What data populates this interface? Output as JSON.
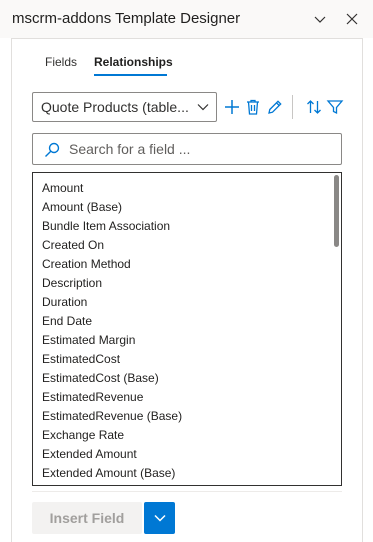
{
  "window": {
    "title": "mscrm-addons Template Designer"
  },
  "tabs": [
    {
      "label": "Fields",
      "active": false
    },
    {
      "label": "Relationships",
      "active": true
    }
  ],
  "relationship_dropdown": {
    "selected": "Quote Products (table..."
  },
  "toolbar": {
    "icons": [
      "add-icon",
      "delete-icon",
      "edit-icon",
      "sort-icon",
      "filter-icon"
    ]
  },
  "search": {
    "placeholder": "Search for a field ...",
    "value": ""
  },
  "fields": [
    "Amount",
    "Amount (Base)",
    "Bundle Item Association",
    "Created On",
    "Creation Method",
    "Description",
    "Duration",
    "End Date",
    "Estimated Margin",
    "EstimatedCost",
    "EstimatedCost (Base)",
    "EstimatedRevenue",
    "EstimatedRevenue (Base)",
    "Exchange Rate",
    "Extended Amount",
    "Extended Amount (Base)"
  ],
  "actions": {
    "insert_label": "Insert Field"
  },
  "colors": {
    "accent": "#0078d4",
    "text": "#323130",
    "disabled_bg": "#f3f2f1",
    "disabled_text": "#a19f9d"
  }
}
